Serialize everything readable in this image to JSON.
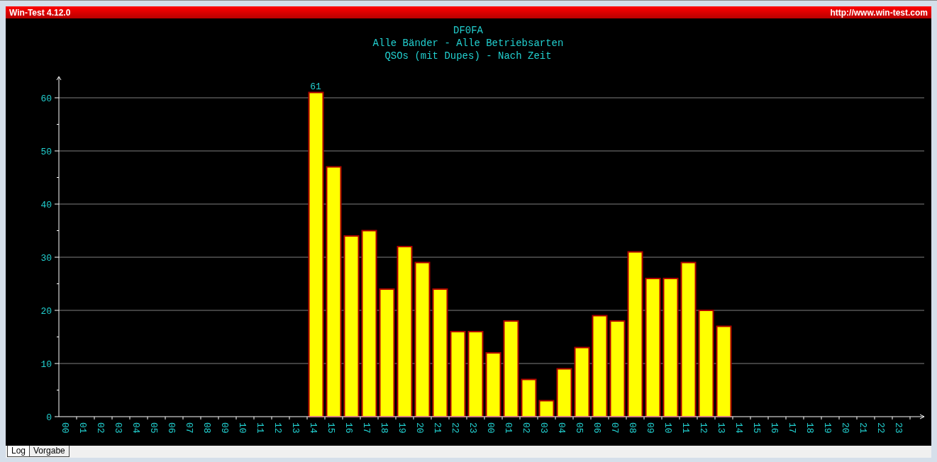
{
  "window": {
    "title": "Win-Test 4.12.0",
    "url": "http://www.win-test.com"
  },
  "chart": {
    "titles": [
      "DF0FA",
      "Alle Bänder - Alle Betriebsarten",
      "QSOs (mit Dupes) - Nach Zeit"
    ],
    "chart_data": {
      "type": "bar",
      "categories": [
        "00",
        "01",
        "02",
        "03",
        "04",
        "05",
        "06",
        "07",
        "08",
        "09",
        "10",
        "11",
        "12",
        "13",
        "14",
        "15",
        "16",
        "17",
        "18",
        "19",
        "20",
        "21",
        "22",
        "23",
        "00",
        "01",
        "02",
        "03",
        "04",
        "05",
        "06",
        "07",
        "08",
        "09",
        "10",
        "11",
        "12",
        "13",
        "14",
        "15",
        "16",
        "17",
        "18",
        "19",
        "20",
        "21",
        "22",
        "23"
      ],
      "values": [
        null,
        null,
        null,
        null,
        null,
        null,
        null,
        null,
        null,
        null,
        null,
        null,
        null,
        null,
        61,
        47,
        34,
        35,
        24,
        32,
        29,
        24,
        16,
        16,
        12,
        18,
        7,
        3,
        9,
        13,
        19,
        18,
        31,
        26,
        26,
        29,
        20,
        17,
        null,
        null,
        null,
        null,
        null,
        null,
        null,
        null,
        null,
        null
      ],
      "ylim": [
        0,
        64
      ],
      "yticks": [
        0,
        10,
        20,
        30,
        40,
        50,
        60
      ],
      "grid": true,
      "annotations": [
        {
          "x": "14",
          "y": 61,
          "text": "61"
        }
      ]
    }
  },
  "tabs": [
    {
      "label": "Log",
      "selected": true
    },
    {
      "label": "Vorgabe",
      "selected": false
    }
  ]
}
